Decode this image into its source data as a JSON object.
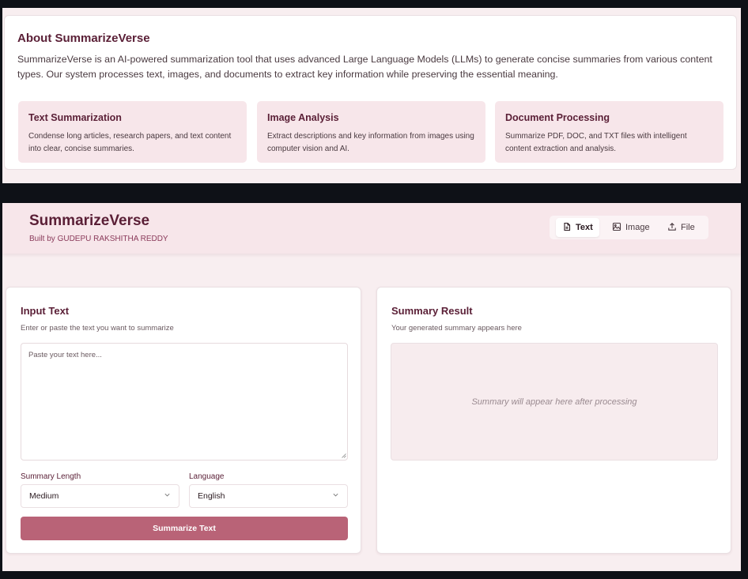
{
  "about": {
    "title": "About SummarizeVerse",
    "description": "SummarizeVerse is an AI-powered summarization tool that uses advanced Large Language Models (LLMs) to generate concise summaries from various content types. Our system processes text, images, and documents to extract key information while preserving the essential meaning.",
    "features": [
      {
        "title": "Text Summarization",
        "description": "Condense long articles, research papers, and text content into clear, concise summaries."
      },
      {
        "title": "Image Analysis",
        "description": "Extract descriptions and key information from images using computer vision and AI."
      },
      {
        "title": "Document Processing",
        "description": "Summarize PDF, DOC, and TXT files with intelligent content extraction and analysis."
      }
    ]
  },
  "header": {
    "title": "SummarizeVerse",
    "subtitle": "Built by GUDEPU RAKSHITHA REDDY",
    "tabs": [
      {
        "label": "Text",
        "icon": "file-text-icon",
        "active": true
      },
      {
        "label": "Image",
        "icon": "image-icon",
        "active": false
      },
      {
        "label": "File",
        "icon": "upload-icon",
        "active": false
      }
    ]
  },
  "input_card": {
    "title": "Input Text",
    "subtitle": "Enter or paste the text you want to summarize",
    "textarea_placeholder": "Paste your text here...",
    "length_label": "Summary Length",
    "length_value": "Medium",
    "language_label": "Language",
    "language_value": "English",
    "submit_label": "Summarize Text"
  },
  "result_card": {
    "title": "Summary Result",
    "subtitle": "Your generated summary appears here",
    "placeholder": "Summary will appear here after processing"
  },
  "colors": {
    "accent": "#b96377",
    "heading": "#5a1f36",
    "panel_bg": "#f8eef0",
    "feature_bg": "#f7e6ea"
  }
}
